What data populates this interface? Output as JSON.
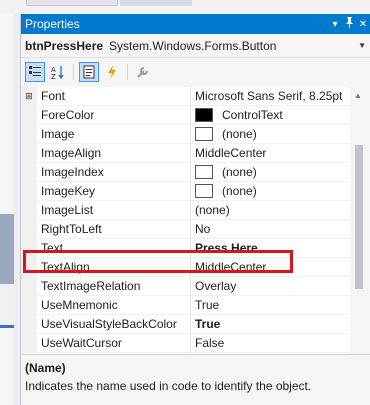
{
  "window": {
    "title": "Properties",
    "controls": [
      "▾",
      "📌",
      "✕"
    ]
  },
  "object": {
    "name": "btnPressHere",
    "type": "System.Windows.Forms.Button"
  },
  "properties": [
    {
      "name": "Font",
      "value": "Microsoft Sans Serif, 8.25pt",
      "expandable": true
    },
    {
      "name": "ForeColor",
      "value": "ControlText",
      "swatch": "#000000"
    },
    {
      "name": "Image",
      "value": "(none)",
      "swatch": "#ffffff"
    },
    {
      "name": "ImageAlign",
      "value": "MiddleCenter"
    },
    {
      "name": "ImageIndex",
      "value": "(none)",
      "swatch": "#ffffff"
    },
    {
      "name": "ImageKey",
      "value": "(none)",
      "swatch": "#ffffff"
    },
    {
      "name": "ImageList",
      "value": "(none)"
    },
    {
      "name": "RightToLeft",
      "value": "No"
    },
    {
      "name": "Text",
      "value": "Press Here",
      "bold": true,
      "highlighted": true
    },
    {
      "name": "TextAlign",
      "value": "MiddleCenter"
    },
    {
      "name": "TextImageRelation",
      "value": "Overlay"
    },
    {
      "name": "UseMnemonic",
      "value": "True"
    },
    {
      "name": "UseVisualStyleBackColor",
      "value": "True",
      "bold": true
    },
    {
      "name": "UseWaitCursor",
      "value": "False"
    }
  ],
  "description": {
    "title": "(Name)",
    "text": "Indicates the name used in code to identify the object."
  },
  "colors": {
    "titlebar": "#007acc",
    "highlight_box": "#d6161c",
    "selected_tool": "#c9def5"
  }
}
